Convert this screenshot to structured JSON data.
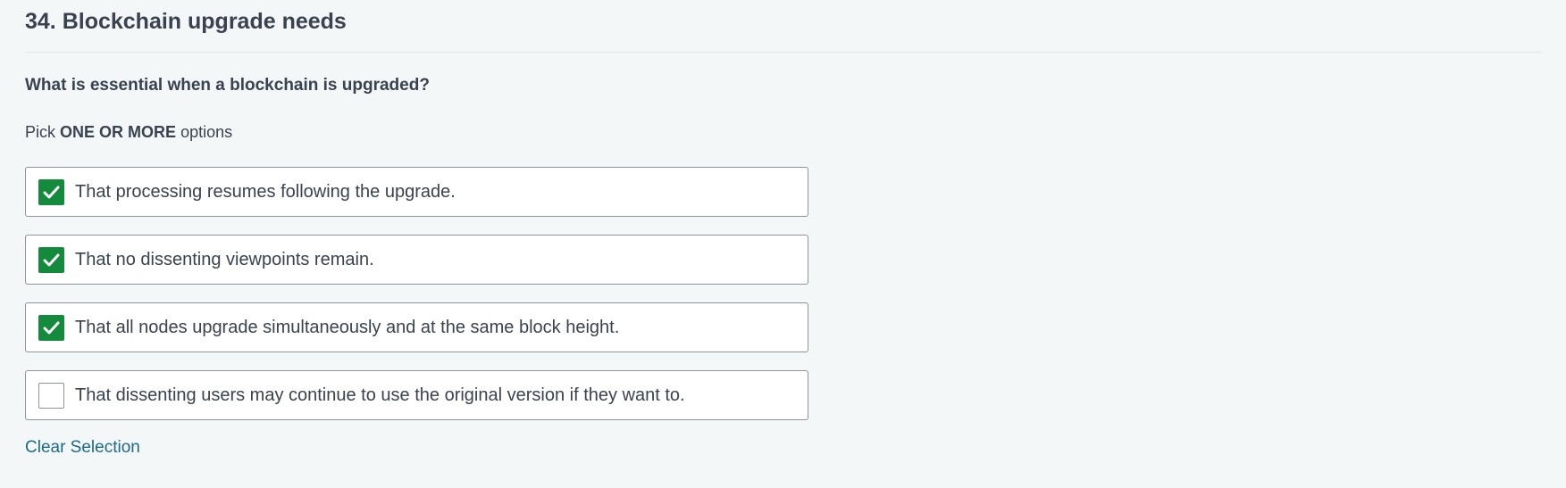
{
  "question": {
    "title": "34. Blockchain upgrade needs",
    "text": "What is essential when a blockchain is upgraded?",
    "instruction_prefix": "Pick",
    "instruction_emphasis": "ONE OR MORE",
    "instruction_suffix": "options"
  },
  "options": [
    {
      "label": "That processing resumes following the upgrade.",
      "checked": true
    },
    {
      "label": "That no dissenting viewpoints remain.",
      "checked": true
    },
    {
      "label": "That all nodes upgrade simultaneously and at the same block height.",
      "checked": true
    },
    {
      "label": "That dissenting users may continue to use the original version if they want to.",
      "checked": false
    }
  ],
  "actions": {
    "clear_label": "Clear Selection"
  },
  "colors": {
    "checked_fill": "#138a3c",
    "link": "#1b6a8a",
    "background": "#f3f7f7"
  },
  "icons": {
    "checkmark": "check-icon"
  }
}
